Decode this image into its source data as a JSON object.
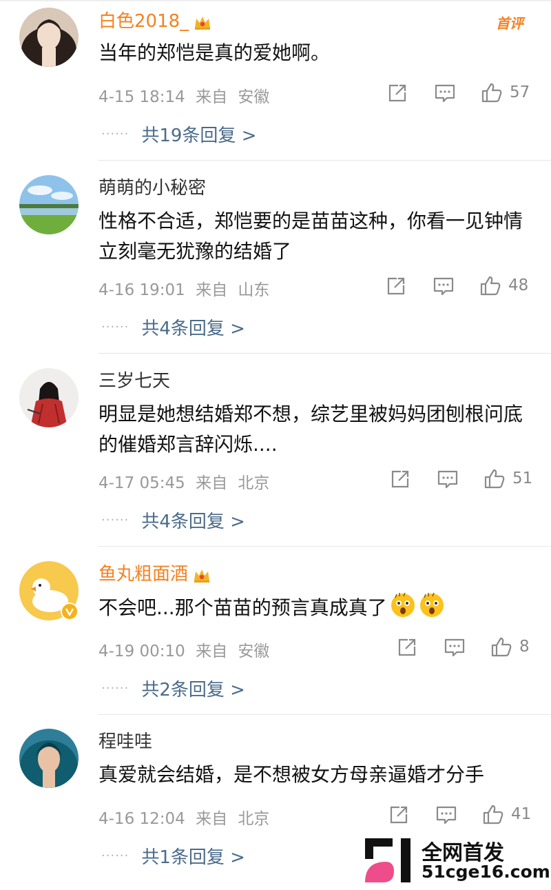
{
  "colors": {
    "vip_name": "#f5811f",
    "reply_link": "#4a6b8a",
    "meta": "#999999",
    "watermark_pink": "#ee4d8b"
  },
  "comments": [
    {
      "username": "白色2018_",
      "vip": true,
      "hot_label": "首评",
      "text": "当年的郑恺是真的爱她啊。",
      "timestamp": "4-15 18:14",
      "from_label": "来自",
      "location": "安徽",
      "likes": "57",
      "replies": "共19条回复 >"
    },
    {
      "username": "萌萌的小秘密",
      "vip": false,
      "text": "性格不合适，郑恺要的是苗苗这种，你看一见钟情立刻毫无犹豫的结婚了",
      "timestamp": "4-16 19:01",
      "from_label": "来自",
      "location": "山东",
      "likes": "48",
      "replies": "共4条回复 >"
    },
    {
      "username": "三岁七天",
      "vip": false,
      "text": "明显是她想结婚郑不想，综艺里被妈妈团刨根问底的催婚郑言辞闪烁....",
      "timestamp": "4-17 05:45",
      "from_label": "来自",
      "location": "北京",
      "likes": "51",
      "replies": "共4条回复 >"
    },
    {
      "username": "鱼丸粗面酒",
      "vip": true,
      "text": "不会吧...那个苗苗的预言真成真了",
      "emojis": [
        "shocked-emoji",
        "shocked-emoji"
      ],
      "timestamp": "4-19 00:10",
      "from_label": "来自",
      "location": "安徽",
      "likes": "8",
      "replies": "共2条回复 >"
    },
    {
      "username": "程哇哇",
      "vip": false,
      "text": "真爱就会结婚，是不想被女方母亲逼婚才分手",
      "timestamp": "4-16 12:04",
      "from_label": "来自",
      "location": "北京",
      "likes": "41",
      "replies": "共1条回复 >"
    }
  ],
  "icons": {
    "share": "share-icon",
    "comment": "comment-icon",
    "like": "like-icon",
    "crown": "crown-icon",
    "verified": "verified-icon"
  },
  "watermark": {
    "line1": "全网首发",
    "line2": "51cge16.com"
  }
}
